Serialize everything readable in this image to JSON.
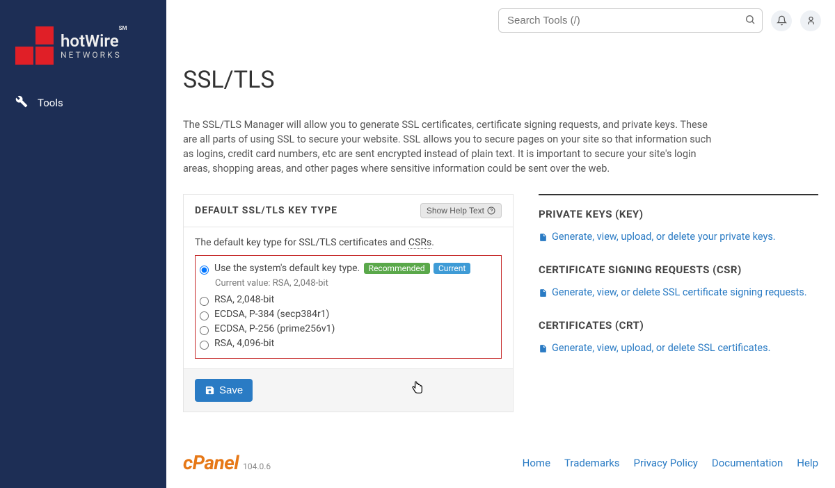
{
  "sidebar": {
    "brand_top": "hotWire",
    "brand_sub": "NETWORKS",
    "brand_sm": "SM",
    "nav": [
      {
        "label": "Tools"
      }
    ]
  },
  "topbar": {
    "search_placeholder": "Search Tools (/)"
  },
  "page": {
    "title": "SSL/TLS",
    "description": "The SSL/TLS Manager will allow you to generate SSL certificates, certificate signing requests, and private keys. These are all parts of using SSL to secure your website. SSL allows you to secure pages on your site so that information such as logins, credit card numbers, etc are sent encrypted instead of plain text. It is important to secure your site's login areas, shopping areas, and other pages where sensitive information could be sent over the web."
  },
  "panel": {
    "title": "DEFAULT SSL/TLS KEY TYPE",
    "help_btn": "Show Help Text",
    "body_desc_prefix": "The default key type for SSL/TLS certificates and ",
    "body_desc_csrs": "CSRs",
    "body_desc_suffix": ".",
    "options": [
      {
        "label": "Use the system's default key type.",
        "selected": true,
        "rec": true,
        "cur": true
      },
      {
        "label": "RSA, 2,048-bit"
      },
      {
        "label": "ECDSA, P-384 (secp384r1)"
      },
      {
        "label": "ECDSA, P-256 (prime256v1)"
      },
      {
        "label": "RSA, 4,096-bit"
      }
    ],
    "badge_rec": "Recommended",
    "badge_cur": "Current",
    "current_value": "Current value: RSA, 2,048-bit",
    "save_label": "Save"
  },
  "right": {
    "sections": [
      {
        "title": "PRIVATE KEYS (KEY)",
        "link": "Generate, view, upload, or delete your private keys."
      },
      {
        "title": "CERTIFICATE SIGNING REQUESTS (CSR)",
        "link": "Generate, view, or delete SSL certificate signing requests."
      },
      {
        "title": "CERTIFICATES (CRT)",
        "link": "Generate, view, upload, or delete SSL certificates."
      }
    ]
  },
  "footer": {
    "cpanel": "cPanel",
    "version": "104.0.6",
    "links": [
      "Home",
      "Trademarks",
      "Privacy Policy",
      "Documentation",
      "Help"
    ]
  }
}
